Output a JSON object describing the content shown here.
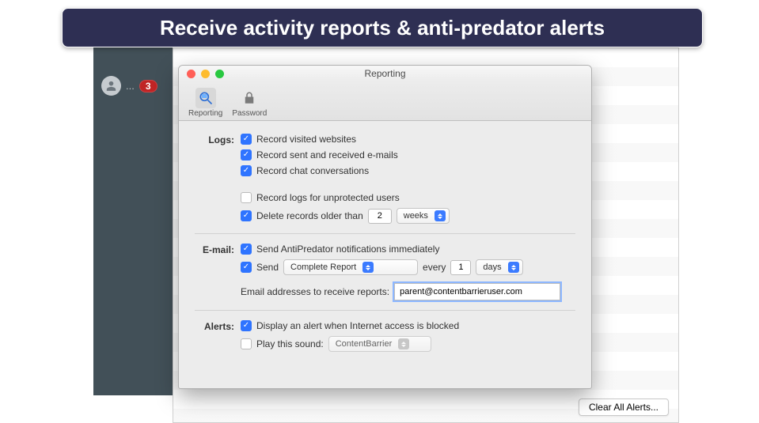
{
  "headline": "Receive activity reports & anti-predator alerts",
  "sidebar": {
    "badge": "3"
  },
  "window": {
    "title": "Reporting",
    "tabs": {
      "reporting": "Reporting",
      "password": "Password"
    }
  },
  "logs": {
    "label": "Logs:",
    "visited": "Record visited websites",
    "emails": "Record sent and received e-mails",
    "chat": "Record chat conversations",
    "unprotected": "Record logs for unprotected users",
    "deleteOlder": "Delete records older than",
    "deleteValue": "2",
    "deleteUnit": "weeks"
  },
  "email": {
    "label": "E-mail:",
    "antipredator": "Send AntiPredator notifications immediately",
    "sendLabel": "Send",
    "reportType": "Complete Report",
    "every": "every",
    "everyValue": "1",
    "everyUnit": "days",
    "addrLabel": "Email addresses to receive reports:",
    "addr": "parent@contentbarrieruser.com"
  },
  "alerts": {
    "label": "Alerts:",
    "blocked": "Display an alert when Internet access is blocked",
    "soundLabel": "Play this sound:",
    "soundValue": "ContentBarrier"
  },
  "footer": {
    "clear": "Clear All Alerts..."
  }
}
